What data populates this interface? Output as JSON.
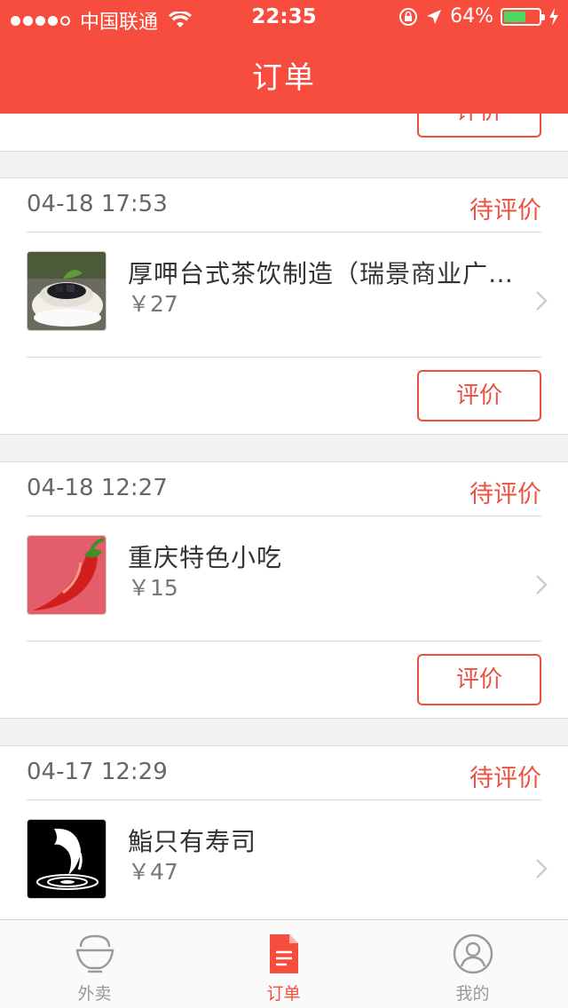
{
  "status_bar": {
    "carrier": "中国联通",
    "time": "22:35",
    "battery": "64%",
    "battery_level": 0.64
  },
  "header": {
    "title": "订单"
  },
  "partial_card": {
    "button_label": "评价"
  },
  "orders": [
    {
      "date": "04-18 17:53",
      "status": "待评价",
      "shop": "厚呷台式茶饮制造（瑞景商业广场店）",
      "price": "￥27",
      "button": "评价",
      "thumb": "grass-jelly-tea-image"
    },
    {
      "date": "04-18 12:27",
      "status": "待评价",
      "shop": "重庆特色小吃",
      "price": "￥15",
      "button": "评价",
      "thumb": "red-chili-image"
    },
    {
      "date": "04-17 12:29",
      "status": "待评价",
      "shop": "鮨只有寿司",
      "price": "￥47",
      "button": "评价",
      "thumb": "koi-fish-logo"
    }
  ],
  "tabbar": {
    "tabs": [
      {
        "label": "外卖",
        "icon": "rice-bowl-icon",
        "active": false
      },
      {
        "label": "订单",
        "icon": "order-document-icon",
        "active": true
      },
      {
        "label": "我的",
        "icon": "user-profile-icon",
        "active": false
      }
    ]
  },
  "colors": {
    "accent": "#f74d3e",
    "battery": "#4cd964"
  }
}
